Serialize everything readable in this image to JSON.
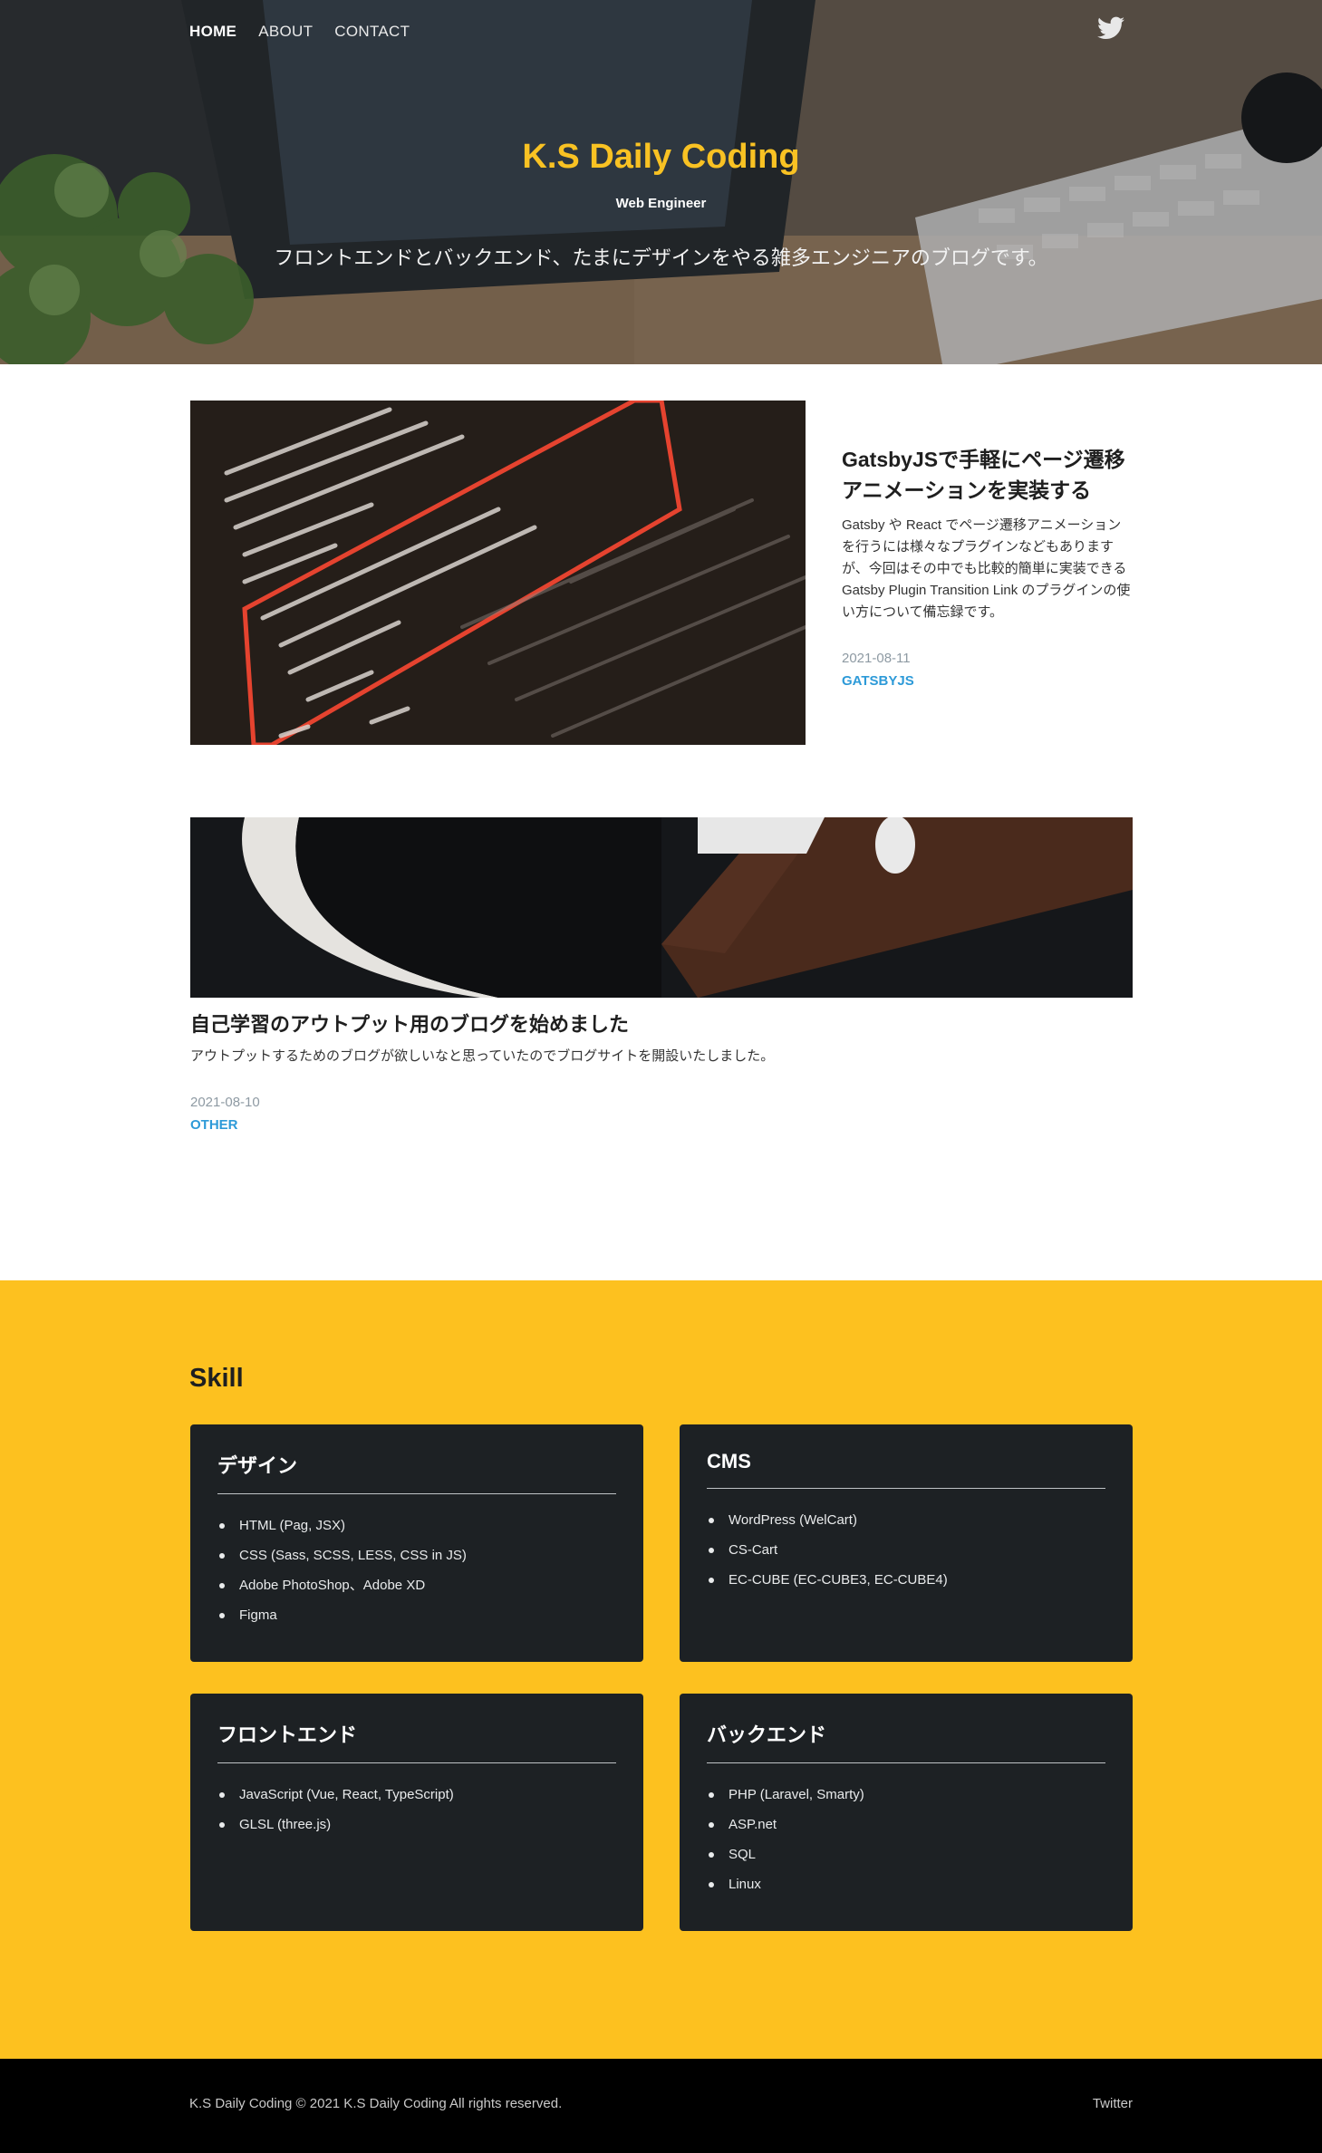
{
  "nav": {
    "items": [
      {
        "label": "HOME",
        "active": true
      },
      {
        "label": "ABOUT",
        "active": false
      },
      {
        "label": "CONTACT",
        "active": false
      }
    ],
    "twitter_icon": "twitter-bird-icon"
  },
  "hero": {
    "title": "K.S Daily Coding",
    "subtitle": "Web Engineer",
    "description": "フロントエンドとバックエンド、たまにデザインをやる雑多エンジニアのブログです。"
  },
  "posts": [
    {
      "title": "GatsbyJSで手軽にページ遷移アニメーションを実装する",
      "excerpt": "Gatsby や React でページ遷移アニメーションを行うには様々なプラグインなどもありますが、今回はその中でも比較的簡単に実装できる Gatsby Plugin Transition Link のプラグインの使い方について備忘録です。",
      "date": "2021-08-11",
      "tag": "GATSBYJS"
    },
    {
      "title": "自己学習のアウトプット用のブログを始めました",
      "excerpt": "アウトプットするためのブログが欲しいなと思っていたのでブログサイトを開設いたしました。",
      "date": "2021-08-10",
      "tag": "OTHER"
    }
  ],
  "skill": {
    "heading": "Skill",
    "cards": [
      {
        "title": "デザイン",
        "items": [
          "HTML (Pag, JSX)",
          "CSS (Sass, SCSS, LESS, CSS in JS)",
          "Adobe PhotoShop、Adobe XD",
          "Figma"
        ]
      },
      {
        "title": "CMS",
        "items": [
          "WordPress (WelCart)",
          "CS-Cart",
          "EC-CUBE (EC-CUBE3, EC-CUBE4)"
        ]
      },
      {
        "title": "フロントエンド",
        "items": [
          "JavaScript (Vue, React, TypeScript)",
          "GLSL (three.js)"
        ]
      },
      {
        "title": "バックエンド",
        "items": [
          "PHP (Laravel, Smarty)",
          "ASP.net",
          "SQL",
          "Linux"
        ]
      }
    ]
  },
  "footer": {
    "copyright": "K.S Daily Coding © 2021 K.S Daily Coding All rights reserved.",
    "twitter": "Twitter"
  },
  "colors": {
    "accent_yellow": "#fdc11f",
    "title_yellow": "#f9c223",
    "tag_blue": "#2d9ad8",
    "card_dark": "#1d2124"
  }
}
